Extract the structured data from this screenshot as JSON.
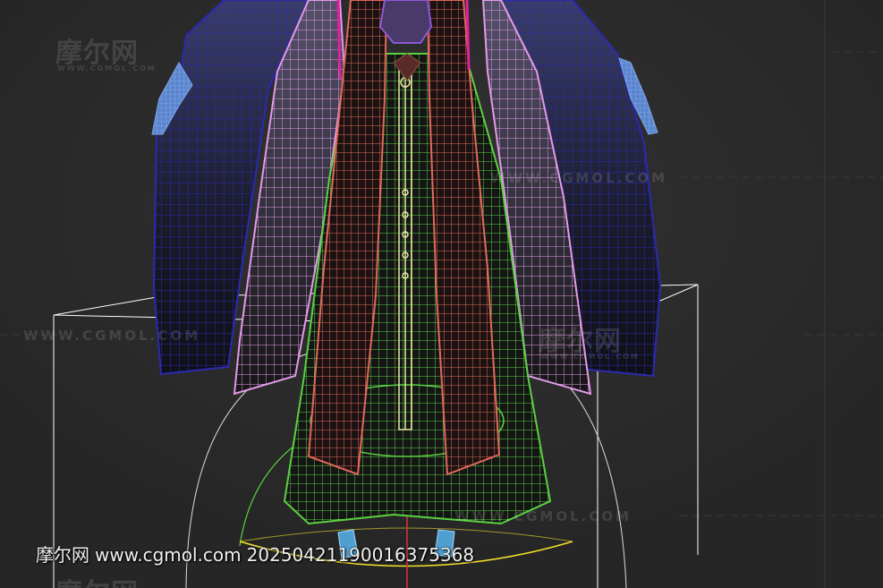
{
  "viewport": {
    "background": "#2b2b2b",
    "grid_color": "#3a3a3a"
  },
  "scene": {
    "objects": [
      {
        "name": "outer-robe",
        "color": "#2a2ab0"
      },
      {
        "name": "inner-robe",
        "color": "#e39ae8"
      },
      {
        "name": "front-panels",
        "color": "#e06a5c"
      },
      {
        "name": "skirt",
        "color": "#5ad142"
      },
      {
        "name": "belt-chain",
        "color": "#e8e8a0"
      },
      {
        "name": "hands",
        "color": "#6f9ae0"
      },
      {
        "name": "bounding-box",
        "color": "#ffffff"
      },
      {
        "name": "ground-ring",
        "color": "#f2e22a"
      },
      {
        "name": "ribbons",
        "color": "#e0209e"
      },
      {
        "name": "collar",
        "color": "#8d58d6"
      }
    ]
  },
  "watermarks": {
    "logo_cn": "摩尔网",
    "logo_url": "WWW.CGMOL.COM",
    "logo_url_small": "WWW.CGMOL.COM"
  },
  "caption": {
    "site_cn": "摩尔网",
    "site_url": "www.cgmol.com",
    "id": "20250421190016375368"
  }
}
